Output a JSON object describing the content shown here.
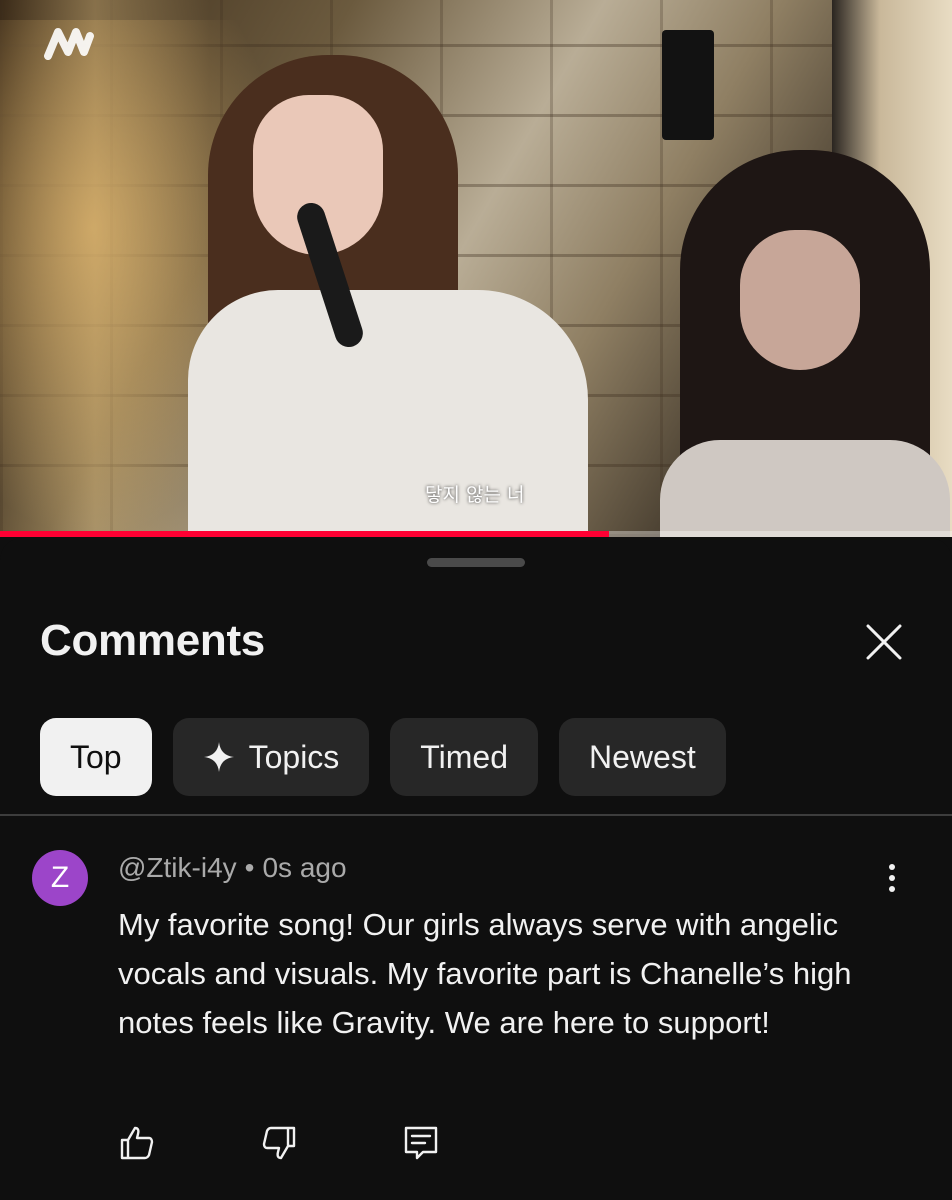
{
  "video": {
    "subtitle": "닿지 않는 너",
    "progress_percent": 64
  },
  "comments_panel": {
    "title": "Comments",
    "close_icon": "close-icon",
    "chips": [
      {
        "label": "Top",
        "active": true
      },
      {
        "label": "Topics",
        "icon": "sparkle-icon",
        "active": false
      },
      {
        "label": "Timed",
        "active": false
      },
      {
        "label": "Newest",
        "active": false
      }
    ]
  },
  "comment": {
    "avatar_letter": "Z",
    "avatar_color": "#9c45c9",
    "author": "@Ztik-i4y",
    "separator": "•",
    "time": "0s ago",
    "text": "My favorite song! Our girls always serve with angelic vocals and visuals. My favorite part is Chanelle’s high notes feels like Gravity. We are here to support!",
    "more_icon": "more-vertical-icon",
    "actions": [
      "like-icon",
      "dislike-icon",
      "reply-icon"
    ]
  },
  "colors": {
    "background": "#0f0f0f",
    "chip": "#272727",
    "chip_active": "#f1f1f1",
    "progress": "#ff0033"
  }
}
